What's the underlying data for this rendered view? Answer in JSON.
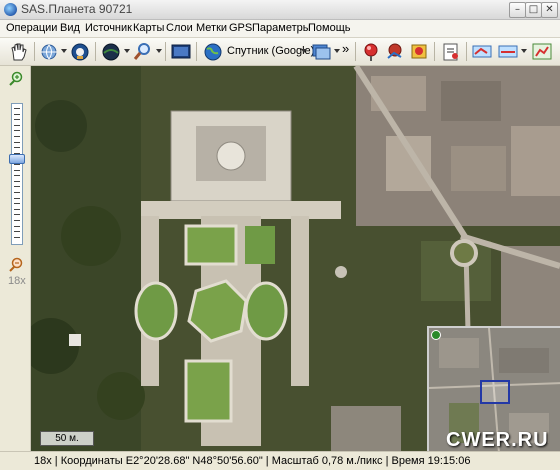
{
  "window": {
    "title": "SAS.Планета 90721"
  },
  "menu": [
    "Операции",
    "Вид",
    "Источник",
    "Карты",
    "Слои",
    "Метки",
    "GPS",
    "Параметры",
    "Помощь"
  ],
  "toolbar": {
    "map_type_label": "Спутник (Google)",
    "overflow": "»"
  },
  "zoom": {
    "level_label": "18x",
    "level_fraction": 0.62
  },
  "map": {
    "scale_label": "50 м."
  },
  "watermark": "CWER.RU",
  "status": {
    "text": "18x | Координаты E2°20'28.68\" N48°50'56.60\"   | Масштаб 0,78 м./пикс | Время 19:15:06"
  },
  "colors": {
    "minimap_frame": "#2338a6",
    "menu_bg": "#f5f4ee",
    "toolbar_bg": "#ece9d8"
  }
}
